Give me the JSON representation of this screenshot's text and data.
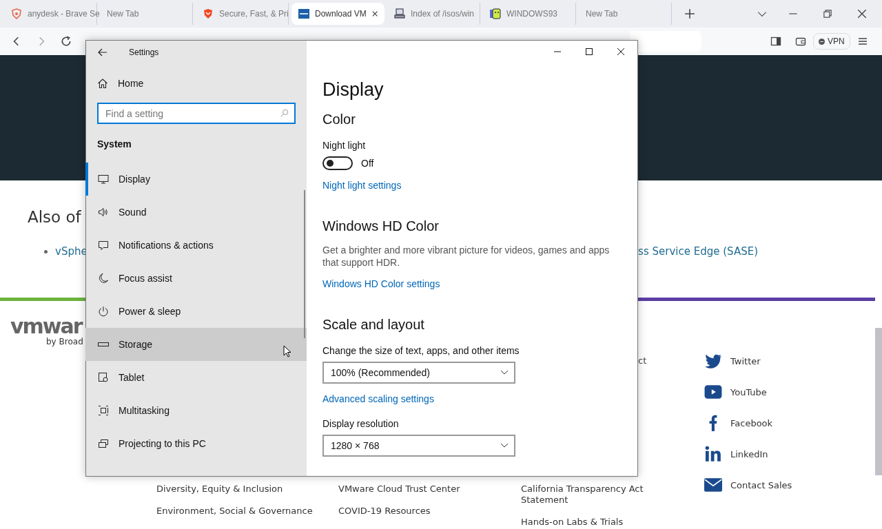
{
  "browser": {
    "tabs": [
      {
        "title": "anydesk - Brave Se",
        "kind": "shield",
        "selected": false
      },
      {
        "title": "New Tab",
        "kind": "none",
        "selected": false
      },
      {
        "title": "Secure, Fast, & Pri",
        "kind": "lion",
        "selected": false
      },
      {
        "title": "Download VM",
        "kind": "square",
        "selected": true
      },
      {
        "title": "Index of /isos/win",
        "kind": "computer",
        "selected": false
      },
      {
        "title": "WINDOWS93",
        "kind": "app",
        "selected": false
      },
      {
        "title": "New Tab",
        "kind": "none",
        "selected": false
      }
    ],
    "vpn": "VPN"
  },
  "web_page": {
    "heading": "Also of",
    "list_item_left": "vSphe",
    "list_item_right": "ss Service Edge (SASE)",
    "logo": "vmwar",
    "logo_byline": "by Broad",
    "footer_fragment": "ct",
    "footer_columns": [
      [
        "Diversity, Equity & Inclusion",
        "Environment, Social & Governance"
      ],
      [
        "VMware Cloud Trust Center",
        "COVID-19 Resources"
      ],
      [
        "California Transparency Act Statement",
        "Hands-on Labs & Trials"
      ]
    ],
    "social": [
      {
        "label": "Twitter",
        "kind": "bird"
      },
      {
        "label": "YouTube",
        "kind": "play"
      },
      {
        "label": "Facebook",
        "kind": "f"
      },
      {
        "label": "LinkedIn",
        "kind": "in"
      },
      {
        "label": "Contact Sales",
        "kind": "mail"
      }
    ]
  },
  "settings": {
    "title": "Settings",
    "home": "Home",
    "search": {
      "placeholder": "Find a setting"
    },
    "section": "System",
    "nav": [
      {
        "label": "Display",
        "kind": "display",
        "selected": true,
        "hovered": false
      },
      {
        "label": "Sound",
        "kind": "sound",
        "selected": false,
        "hovered": false
      },
      {
        "label": "Notifications & actions",
        "kind": "notifications",
        "selected": false,
        "hovered": false
      },
      {
        "label": "Focus assist",
        "kind": "moon",
        "selected": false,
        "hovered": false
      },
      {
        "label": "Power & sleep",
        "kind": "power",
        "selected": false,
        "hovered": false
      },
      {
        "label": "Storage",
        "kind": "storage",
        "selected": false,
        "hovered": true
      },
      {
        "label": "Tablet",
        "kind": "tablet",
        "selected": false,
        "hovered": false
      },
      {
        "label": "Multitasking",
        "kind": "multitasking",
        "selected": false,
        "hovered": false
      },
      {
        "label": "Projecting to this PC",
        "kind": "projecting",
        "selected": false,
        "hovered": false
      }
    ],
    "page_title": "Display",
    "color": {
      "heading": "Color",
      "night_light_label": "Night light",
      "night_light_on": false,
      "night_light_state": "Off",
      "link": "Night light settings"
    },
    "hd": {
      "heading": "Windows HD Color",
      "description": "Get a brighter and more vibrant picture for videos, games and apps that support HDR.",
      "link": "Windows HD Color settings"
    },
    "scale": {
      "heading": "Scale and layout",
      "size_label": "Change the size of text, apps, and other items",
      "size_value": "100% (Recommended)",
      "advanced_link": "Advanced scaling settings",
      "resolution_label": "Display resolution",
      "resolution_value": "1280 × 768"
    }
  }
}
